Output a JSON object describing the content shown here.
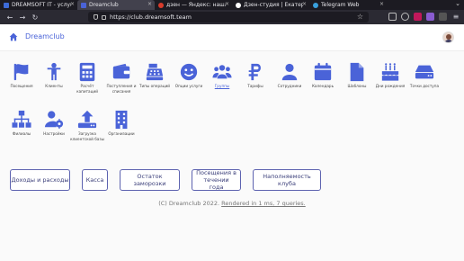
{
  "browser": {
    "tabs": [
      {
        "label": "DREAMSOFT IT - услуги",
        "color": "#3d6bd8",
        "active": false
      },
      {
        "label": "Dreamclub",
        "color": "#4a63d8",
        "active": true
      },
      {
        "label": "дзен — Яндекс: нашлос",
        "color": "#d83b2b",
        "active": false
      },
      {
        "label": "Дзен-студия | Екатерин",
        "color": "#ffffff",
        "active": false
      },
      {
        "label": "Telegram Web",
        "color": "#39a0dd",
        "active": false
      }
    ],
    "url": "https://club.dreamsoft.team"
  },
  "header": {
    "brand": "Dreamclub"
  },
  "tiles": [
    {
      "label": "Посещения",
      "icon": "flag-icon"
    },
    {
      "label": "Клиенты",
      "icon": "person-icon"
    },
    {
      "label": "Расчёт капитаций",
      "icon": "calculator-icon"
    },
    {
      "label": "Поступления и списания",
      "icon": "wallet-icon"
    },
    {
      "label": "Типы операций",
      "icon": "cash-register-icon"
    },
    {
      "label": "Опции услуги",
      "icon": "smile-icon"
    },
    {
      "label": "Группы",
      "icon": "users-icon"
    },
    {
      "label": "Тарифы",
      "icon": "ruble-icon"
    },
    {
      "label": "Сотрудники",
      "icon": "user-icon"
    },
    {
      "label": "Календарь",
      "icon": "calendar-icon"
    },
    {
      "label": "Шаблоны",
      "icon": "file-icon"
    },
    {
      "label": "Дни рождения",
      "icon": "cake-icon"
    },
    {
      "label": "Точки доступа",
      "icon": "hdd-icon"
    },
    {
      "label": "Филиалы",
      "icon": "sitemap-icon"
    },
    {
      "label": "Настройки",
      "icon": "user-cog-icon"
    },
    {
      "label": "Загрузка клиентской базы",
      "icon": "upload-icon"
    },
    {
      "label": "Организации",
      "icon": "building-icon"
    }
  ],
  "reports": [
    {
      "label": "Доходы и расходы"
    },
    {
      "label": "Касса"
    },
    {
      "label": "Остаток заморозки"
    },
    {
      "label": "Посещения в течении года"
    },
    {
      "label": "Наполняемость клуба"
    }
  ],
  "footer": {
    "copyright": "(C) Dreamclub 2022.",
    "render": "Rendered in 1 ms, 7 queries."
  },
  "colors": {
    "accent": "#4a63d8"
  }
}
